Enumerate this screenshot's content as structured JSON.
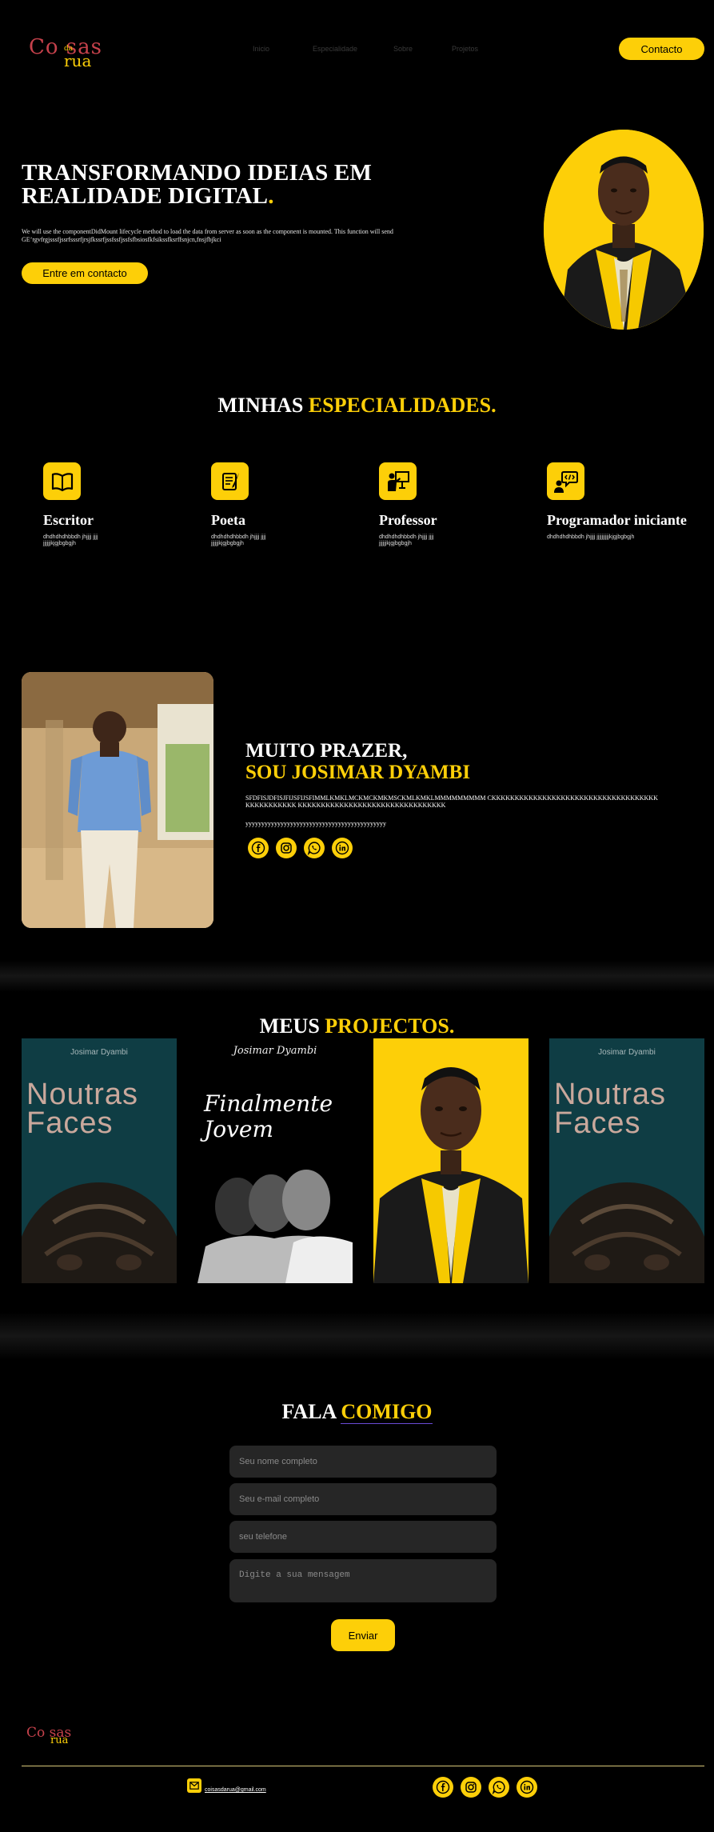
{
  "brand": {
    "logo_part1": "Co sas",
    "logo_part2": "da",
    "logo_part3": "rua"
  },
  "nav": {
    "items": [
      "Inicio",
      "Especialidade",
      "Sobre",
      "Projetos"
    ],
    "contact_button": "Contacto"
  },
  "hero": {
    "title_line1": "TRANSFORMANDO IDEIAS EM",
    "title_line2": "REALIDADE DIGITAL",
    "title_dot": ".",
    "description": "We will use the componentDidMount lifecycle method to load the data from server as soon as the component is mounted. This function will send GE’rgvfrgjsssfjssrfsssrfjrsjfkssrfjssfssfjssfsfbsiosfkfsikssfksrffsnjcn,fnsjfbjkci",
    "button": "Entre em contacto"
  },
  "specialties": {
    "title_white": "MINHAS",
    "title_yellow": "ESPECIALIDADES.",
    "items": [
      {
        "name": "Escritor",
        "desc": "dhdhdhdhbbdh jhjjjj jjjjjjjjjjkjgjbgbgjh",
        "icon": "open-book-icon"
      },
      {
        "name": "Poeta",
        "desc": "dhdhdhdhbbdh jhjjjj jjjjjjjjjjkjgjbgbgjh",
        "icon": "quill-scroll-icon"
      },
      {
        "name": "Professor",
        "desc": "dhdhdhdhbbdh jhjjjj jjjjjjjjjjkjgjbgbgjh",
        "icon": "teacher-board-icon"
      },
      {
        "name": "Programador iniciante",
        "desc": "dhdhdhdhbbdh jhjjjj jjjjjjjjjjkjgjbgbgjh",
        "icon": "coder-icon"
      }
    ]
  },
  "about": {
    "title_line1": "MUITO PRAZER,",
    "title_line2": "SOU JOSIMAR DYAMBI",
    "text1": "SFDFISJDFISJFIJSFIJSFIMMLKMKLMCKMCKMKMSCKMLKMKLMMMMMMMMM CKKKKKKKKKKKKKKKKKKKKKKKKKKKKKKKKKKKKKKKKKKKKKKK KKKKKKKKKKKKKKKKKKKKKKKKKKKKKKKK",
    "text2": "yyyyyyyyyyyyyyyyyyyyyyyyyyyyyyyyyyyyyyyyyyyy",
    "socials": [
      "facebook-icon",
      "instagram-icon",
      "whatsapp-icon",
      "linkedin-icon"
    ]
  },
  "projects": {
    "title_white": "MEUS",
    "title_yellow": "PROJECTOS.",
    "items": [
      {
        "author": "Josimar Dyambi",
        "title": "Noutras Faces"
      },
      {
        "author": "Josimar Dyambi",
        "title": "Finalmente Jovem"
      },
      {
        "author": "",
        "title": ""
      },
      {
        "author": "Josimar Dyambi",
        "title": "Noutras Faces"
      }
    ]
  },
  "contact": {
    "title_white": "FALA",
    "title_yellow": "COMIGO",
    "name_placeholder": "Seu nome completo",
    "email_placeholder": "Seu e-mail completo",
    "phone_placeholder": "seu telefone",
    "message_placeholder": "Digite a sua mensagem",
    "submit": "Enviar"
  },
  "footer": {
    "logo_part1": "Co sas",
    "logo_part2": "rua",
    "email": "coisasdarua@gmail.com",
    "socials": [
      "facebook-icon",
      "instagram-icon",
      "whatsapp-icon",
      "linkedin-icon"
    ]
  },
  "colors": {
    "accent": "#fdcf08",
    "background": "#000000",
    "logo_red": "#c5414b",
    "field": "#262626",
    "teal": "#0f3d44"
  }
}
